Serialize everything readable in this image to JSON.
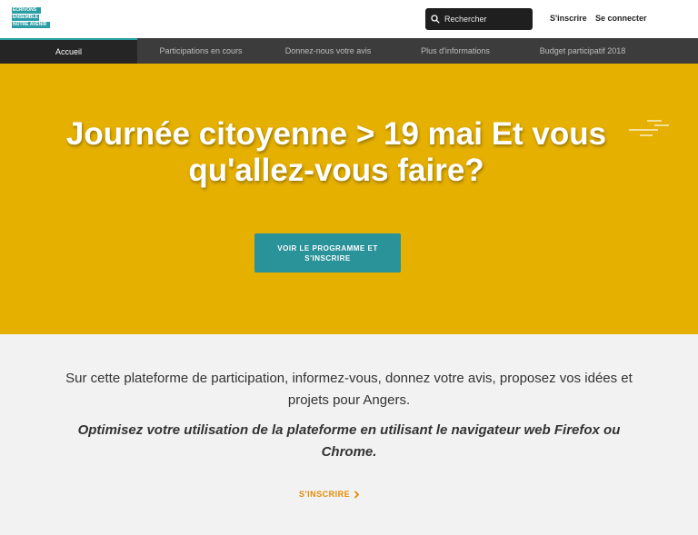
{
  "logo": {
    "lines": [
      "ÉCRIVONS",
      "ENSEMBLE",
      "NOTRE AVENIR"
    ]
  },
  "header": {
    "search_placeholder": "Rechercher",
    "signup_label": "S'inscrire",
    "login_label": "Se connecter"
  },
  "nav": {
    "items": [
      {
        "label": "Accueil",
        "active": true
      },
      {
        "label": "Participations en cours"
      },
      {
        "label": "Donnez-nous votre avis"
      },
      {
        "label": "Plus d'informations"
      },
      {
        "label": "Budget participatif 2018"
      }
    ]
  },
  "hero": {
    "title": "Journée citoyenne > 19 mai Et vous qu'allez-vous faire?",
    "button_label": "VOIR LE PROGRAMME ET S'INSCRIRE",
    "bg_color": "#e5b000"
  },
  "content": {
    "intro": "Sur cette plateforme de participation, informez-vous, donnez votre avis, proposez vos idées et projets pour Angers.",
    "tip": "Optimisez votre utilisation de la plateforme en utilisant le navigateur web Firefox ou Chrome.",
    "cta_label": "S'INSCRIRE"
  },
  "colors": {
    "accent": "#2a9da5",
    "cta": "#e58a00",
    "nav_bg": "#3c3c3c"
  },
  "icons": {
    "search": "search-icon",
    "cta": "chevron-right-icon",
    "hero_deco": "lines-decoration-icon"
  }
}
